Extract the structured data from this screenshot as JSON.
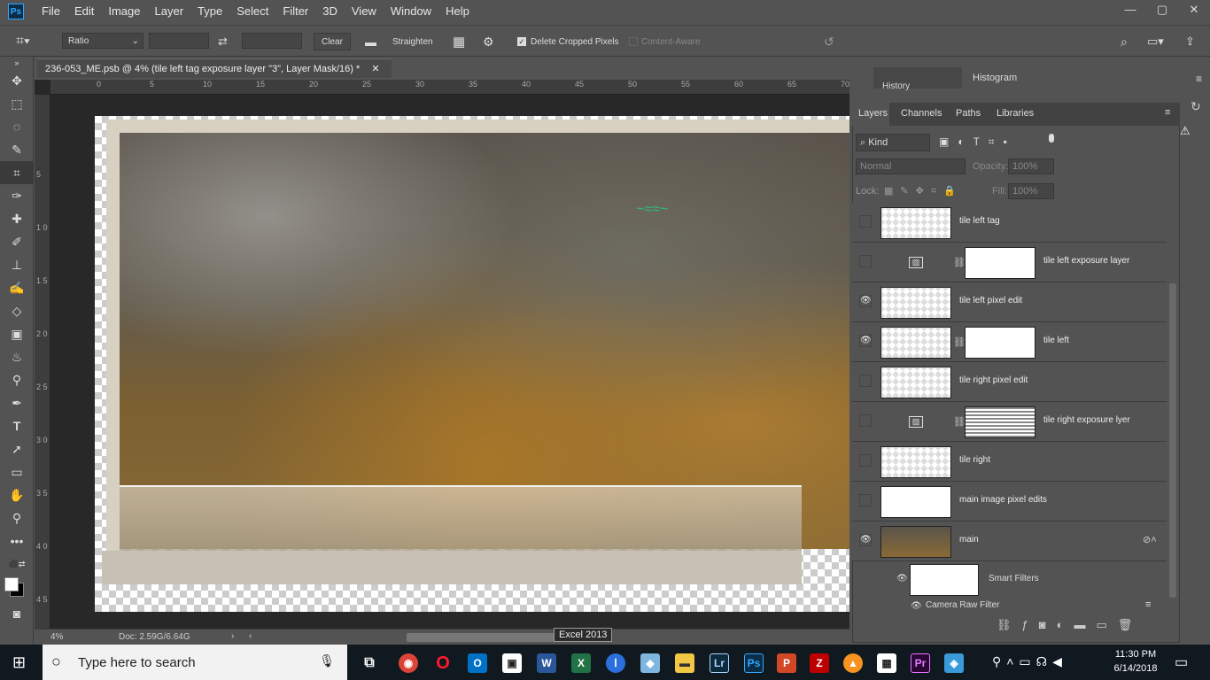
{
  "app_logo": "Ps",
  "menu": [
    "File",
    "Edit",
    "Image",
    "Layer",
    "Type",
    "Select",
    "Filter",
    "3D",
    "View",
    "Window",
    "Help"
  ],
  "window_controls": [
    "—",
    "▢",
    "✕"
  ],
  "options": {
    "ratio": "Ratio",
    "clear": "Clear",
    "straighten": "Straighten",
    "delete_cropped": "Delete Cropped Pixels",
    "content_aware": "Content-Aware"
  },
  "document_tab": "236-053_ME.psb @ 4% (tile left tag exposure layer \"3\", Layer Mask/16) *",
  "ruler_top": [
    "0",
    "5",
    "10",
    "15",
    "20",
    "25",
    "30",
    "35",
    "40",
    "45",
    "50",
    "55",
    "60",
    "65",
    "70"
  ],
  "ruler_left": [
    "5",
    "1 0",
    "1 5",
    "2 0",
    "2 5",
    "3 0",
    "3 5",
    "4 0",
    "4 5"
  ],
  "status": {
    "zoom": "4%",
    "doc": "Doc: 2.59G/6.64G"
  },
  "tooltip": "Excel 2013",
  "panels": {
    "history": "History",
    "histogram": "Histogram",
    "tabs": [
      "Layers",
      "Channels",
      "Paths",
      "Libraries"
    ],
    "kind": "Kind",
    "blend": "Normal",
    "opacity_label": "Opacity:",
    "opacity": "100%",
    "lock_label": "Lock:",
    "fill_label": "Fill:",
    "fill": "100%"
  },
  "layers": [
    {
      "name": "tile left tag",
      "visible": false
    },
    {
      "name": "tile left exposure layer",
      "visible": false
    },
    {
      "name": "tile left pixel edit",
      "visible": true
    },
    {
      "name": "tile left",
      "visible": true
    },
    {
      "name": "tile right pixel edit",
      "visible": false
    },
    {
      "name": "tile right exposure lyer",
      "visible": false
    },
    {
      "name": "tile right",
      "visible": false
    },
    {
      "name": "main image pixel edits",
      "visible": false
    },
    {
      "name": "main",
      "visible": true
    }
  ],
  "smart_filters": "Smart Filters",
  "camera_raw": "Camera Raw Filter",
  "taskbar": {
    "search_placeholder": "Type here to search",
    "time": "11:30 PM",
    "date": "6/14/2018"
  },
  "taskbar_apps": [
    "Chrome",
    "Opera",
    "Outlook",
    "Word",
    "Excel",
    "Explorer",
    "Lr",
    "Ps",
    "PowerPoint",
    "FileZilla",
    "Pr"
  ]
}
